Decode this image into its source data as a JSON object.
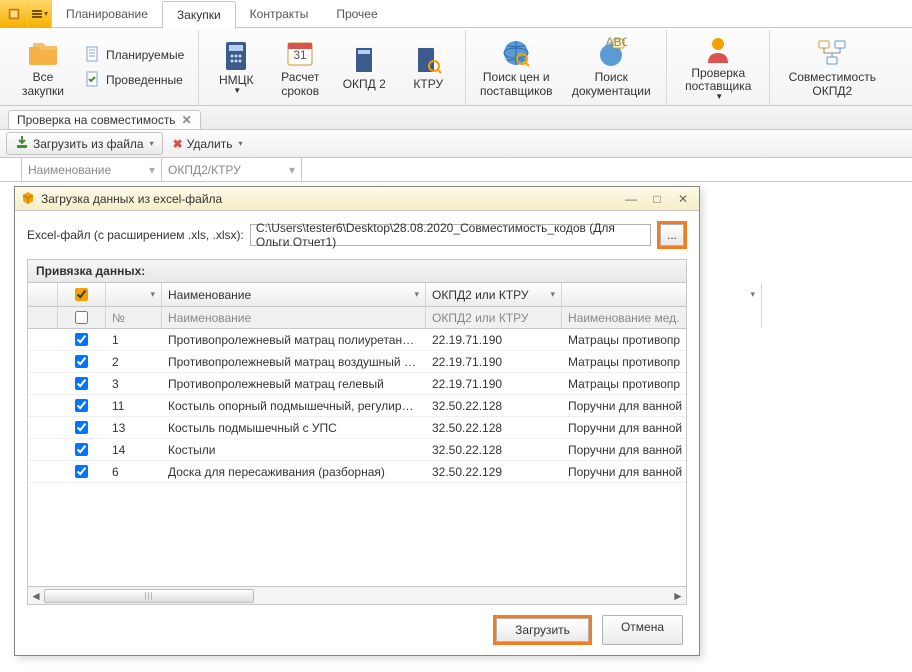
{
  "ribbon": {
    "tabs": [
      "Планирование",
      "Закупки",
      "Контракты",
      "Прочее"
    ],
    "active_tab": "Закупки",
    "group1_big": "Все закупки",
    "group1_small1": "Планируемые",
    "group1_small2": "Проведенные",
    "nmck": "НМЦК",
    "raschet": "Расчет\nсроков",
    "okpd2": "ОКПД 2",
    "ktru": "КТРУ",
    "poisk_cen": "Поиск цен и\nпоставщиков",
    "poisk_doc": "Поиск\nдокументации",
    "proverka_post": "Проверка\nпоставщика",
    "sovmest": "Совместимость\nОКПД2"
  },
  "doctab": {
    "label": "Проверка на совместимость"
  },
  "toolbar": {
    "load": "Загрузить из файла",
    "delete": "Удалить"
  },
  "filters": {
    "name": "Наименование",
    "okpd": "ОКПД2/КТРУ"
  },
  "dialog": {
    "title": "Загрузка данных из excel-файла",
    "file_label": "Excel-файл (с расширением .xls, .xlsx):",
    "file_value": "C:\\Users\\tester6\\Desktop\\28.08.2020_Совместимость_кодов (Для Ольги Отчет1)",
    "browse": "...",
    "grid_caption": "Привязка данных:",
    "header_name": "Наименование",
    "header_okpd": "ОКПД2 или КТРУ",
    "sub_no": "№",
    "sub_name": "Наименование",
    "sub_okpd": "ОКПД2 или КТРУ",
    "sub_med": "Наименование мед.",
    "rows": [
      {
        "no": "1",
        "name": "Противопролежневый матрац полиуретановый",
        "okpd": "22.19.71.190",
        "med": "Матрацы противопр"
      },
      {
        "no": "2",
        "name": "Противопролежневый матрац воздушный (с компрессо...",
        "okpd": "22.19.71.190",
        "med": "Матрацы противопр"
      },
      {
        "no": "3",
        "name": "Противопролежневый матрац гелевый",
        "okpd": "22.19.71.190",
        "med": "Матрацы противопр"
      },
      {
        "no": "11",
        "name": "Костыль опорный подмышечный, регулируемый по вы...",
        "okpd": "32.50.22.128",
        "med": "Поручни для ванной"
      },
      {
        "no": "13",
        "name": "Костыль подмышечный с УПС",
        "okpd": "32.50.22.128",
        "med": "Поручни для ванной"
      },
      {
        "no": "14",
        "name": "Костыли",
        "okpd": "32.50.22.128",
        "med": "Поручни для ванной"
      },
      {
        "no": "6",
        "name": "Доска для пересаживания (разборная)",
        "okpd": "32.50.22.129",
        "med": "Поручни для ванной"
      }
    ],
    "btn_load": "Загрузить",
    "btn_cancel": "Отмена"
  }
}
